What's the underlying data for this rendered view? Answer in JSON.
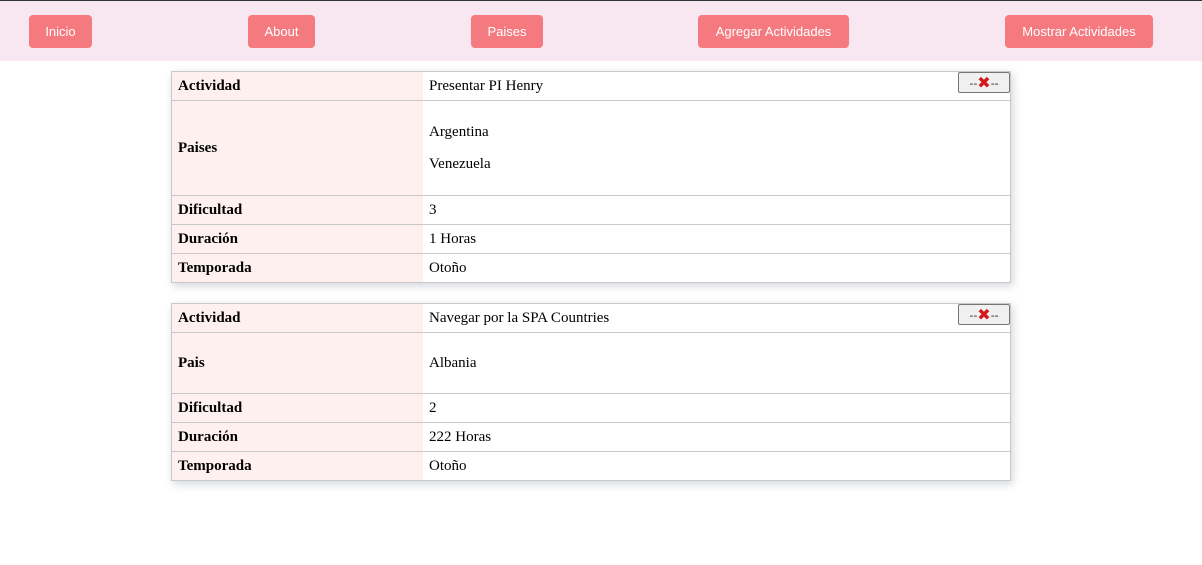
{
  "nav": {
    "inicio": "Inicio",
    "about": "About",
    "paises": "Paises",
    "agregar": "Agregar Actividades",
    "mostrar": "Mostrar Actividades"
  },
  "labels": {
    "actividad": "Actividad",
    "paises": "Paises",
    "pais": "Pais",
    "dificultad": "Dificultad",
    "duracion": "Duración",
    "temporada": "Temporada",
    "delete_left": "--",
    "delete_icon": "✖",
    "delete_right": "--"
  },
  "activities": [
    {
      "name": "Presentar PI Henry",
      "countries": [
        "Argentina",
        "Venezuela"
      ],
      "dificultad": "3",
      "duracion": "1 Horas",
      "temporada": "Otoño"
    },
    {
      "name": "Navegar por la SPA Countries",
      "countries": [
        "Albania"
      ],
      "dificultad": "2",
      "duracion": "222 Horas",
      "temporada": "Otoño"
    }
  ],
  "colors": {
    "nav_bg": "#f8e6f1",
    "button_bg": "#f57a7f",
    "label_bg": "#fff0f0",
    "delete_icon": "#d01919"
  }
}
